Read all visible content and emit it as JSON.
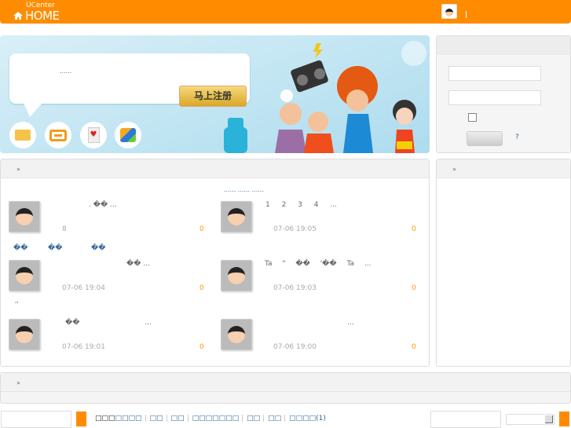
{
  "header": {
    "brand_small": "UCenter",
    "brand": "HOME",
    "separator": "|"
  },
  "banner": {
    "bubble_text": "......",
    "register_button": "马上注册",
    "icons": [
      "message-icon",
      "camera-icon",
      "card-icon",
      "users-icon"
    ]
  },
  "login": {
    "username": "",
    "password": "",
    "remember": false,
    "help": "?"
  },
  "main": {
    "title": "»",
    "tabs": [
      "......",
      "......",
      "......"
    ],
    "feed": [
      {
        "text": ". ��  ...",
        "meta": "8",
        "count": "0"
      },
      {
        "text": "1 2 3 4 ...",
        "meta": "07-06 19:05",
        "count": "0"
      },
      {
        "text": "�� ...",
        "meta": "07-06 19:04",
        "count": "0"
      },
      {
        "text": "Ta \" �� '�� Ta ...",
        "meta": "07-06 19:03",
        "count": "0"
      },
      {
        "text": "�� ...",
        "meta": "07-06 19:01",
        "count": "0"
      },
      {
        "text": "...",
        "meta": "07-06 19:00",
        "count": "0"
      }
    ],
    "links": [
      "��",
      "��",
      "��"
    ],
    "quote_mark": "''"
  },
  "side": {
    "title": "»"
  },
  "bottom": {
    "title": "»"
  },
  "footer": {
    "prefix": "□□□",
    "links": [
      "□□□□",
      "□□",
      "□□",
      "□□□□□□□",
      "□□",
      "□□",
      "□□□□"
    ],
    "count": "(1)"
  },
  "colors": {
    "accent": "#ff8c00",
    "link": "#336699",
    "count": "#ff9900"
  }
}
